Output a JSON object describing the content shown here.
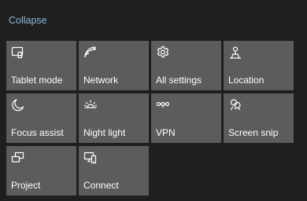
{
  "header": {
    "collapse_label": "Collapse"
  },
  "tiles": [
    {
      "id": "tablet-mode",
      "label": "Tablet mode",
      "icon": "tablet-mode-icon"
    },
    {
      "id": "network",
      "label": "Network",
      "icon": "network-icon"
    },
    {
      "id": "all-settings",
      "label": "All settings",
      "icon": "gear-icon"
    },
    {
      "id": "location",
      "label": "Location",
      "icon": "location-icon"
    },
    {
      "id": "focus-assist",
      "label": "Focus assist",
      "icon": "moon-icon"
    },
    {
      "id": "night-light",
      "label": "Night light",
      "icon": "sun-icon"
    },
    {
      "id": "vpn",
      "label": "VPN",
      "icon": "vpn-icon"
    },
    {
      "id": "screen-snip",
      "label": "Screen snip",
      "icon": "screen-snip-icon"
    },
    {
      "id": "project",
      "label": "Project",
      "icon": "project-icon"
    },
    {
      "id": "connect",
      "label": "Connect",
      "icon": "connect-icon"
    }
  ],
  "colors": {
    "background": "#1f1f1f",
    "tile": "#5c5c5c",
    "link": "#8ab8e0",
    "text": "#ffffff"
  }
}
